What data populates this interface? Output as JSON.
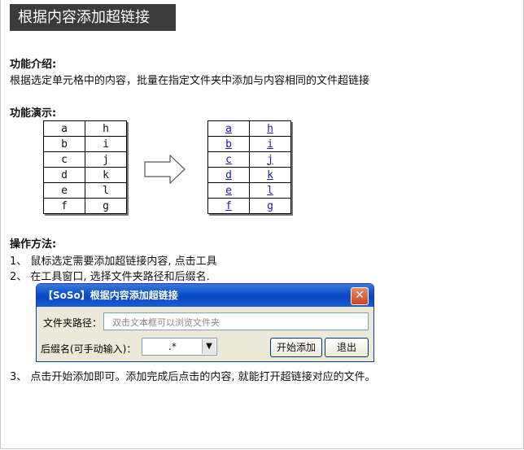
{
  "page_title": "根据内容添加超链接",
  "intro": {
    "heading": "功能介绍:",
    "body": "根据选定单元格中的内容，批量在指定文件夹中添加与内容相同的文件超链接"
  },
  "demo": {
    "heading": "功能演示:",
    "left_table": [
      [
        "a",
        "h"
      ],
      [
        "b",
        "i"
      ],
      [
        "c",
        "j"
      ],
      [
        "d",
        "k"
      ],
      [
        "e",
        "l"
      ],
      [
        "f",
        "g"
      ]
    ],
    "right_table": [
      [
        "a",
        "h"
      ],
      [
        "b",
        "i"
      ],
      [
        "c",
        "j"
      ],
      [
        "d",
        "k"
      ],
      [
        "e",
        "l"
      ],
      [
        "f",
        "g"
      ]
    ]
  },
  "steps": {
    "heading": "操作方法:",
    "step1": "1、 鼠标选定需要添加超链接内容, 点击工具",
    "step2": "2、 在工具窗口, 选择文件夹路径和后缀名.",
    "step3": "3、 点击开始添加即可。添加完成后点击的内容, 就能打开超链接对应的文件。"
  },
  "dialog": {
    "title": "【SoSo】根据内容添加超链接",
    "close_glyph": "✕",
    "folder_label": "文件夹路径：",
    "folder_placeholder": "双击文本框可以浏览文件夹",
    "suffix_label": "后缀名(可手动输入)：",
    "suffix_value": ".*",
    "start_button": "开始添加",
    "exit_button": "退出"
  }
}
